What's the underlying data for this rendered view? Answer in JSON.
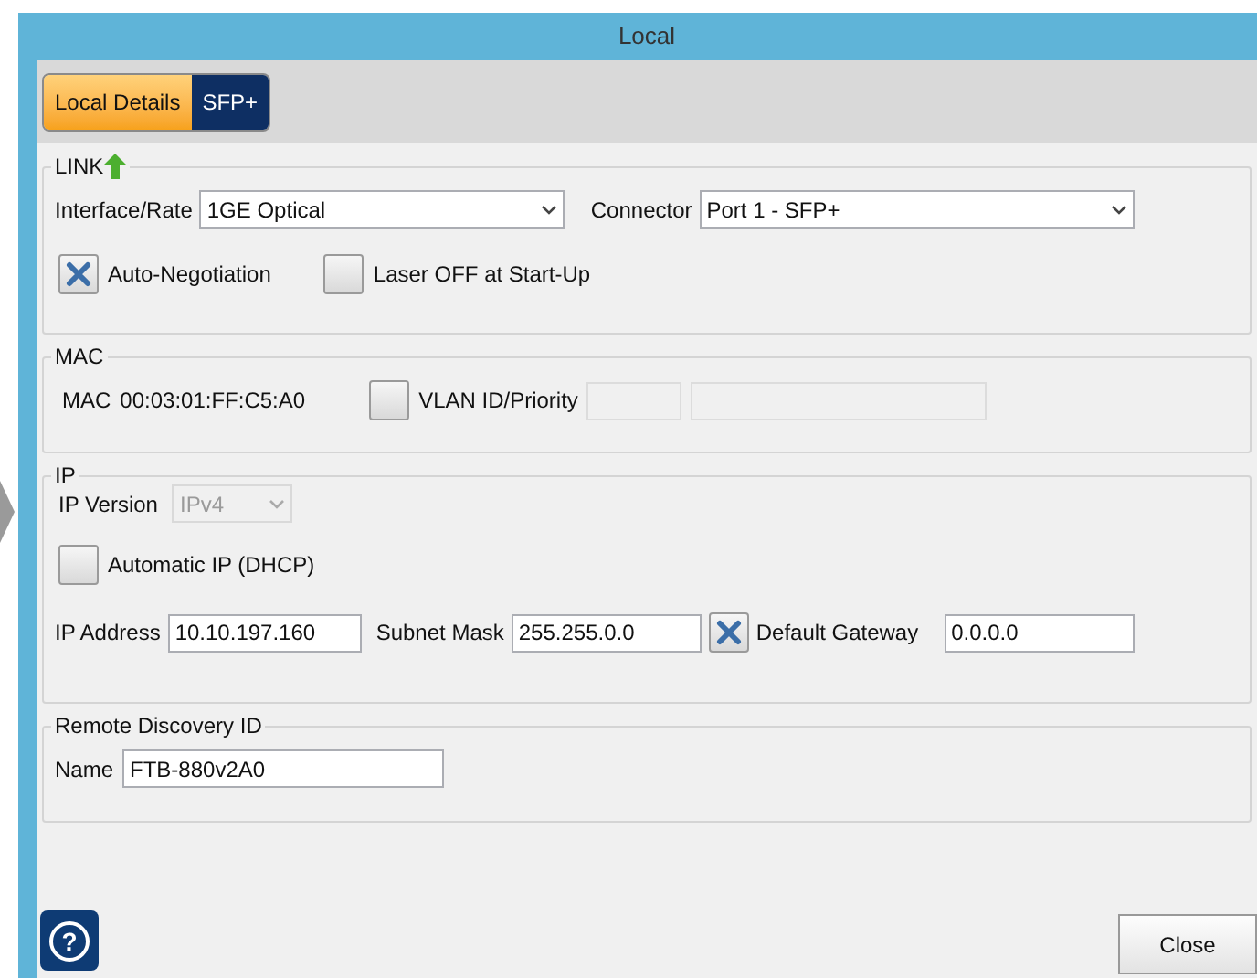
{
  "window": {
    "title": "Local"
  },
  "tabs": [
    {
      "label": "Local Details",
      "selected": true
    },
    {
      "label": "SFP+",
      "selected": false
    }
  ],
  "link": {
    "title": "LINK",
    "interface_rate": {
      "label": "Interface/Rate",
      "value": "1GE Optical"
    },
    "connector": {
      "label": "Connector",
      "value": "Port 1 - SFP+"
    },
    "auto_negotiation": {
      "label": "Auto-Negotiation",
      "checked": true
    },
    "laser_off": {
      "label": "Laser OFF at Start-Up",
      "checked": false
    }
  },
  "mac": {
    "title": "MAC",
    "label": "MAC",
    "value": "00:03:01:FF:C5:A0",
    "vlan": {
      "label": "VLAN ID/Priority",
      "checked": false
    }
  },
  "ip": {
    "title": "IP",
    "ip_version": {
      "label": "IP Version",
      "value": "IPv4",
      "disabled": true
    },
    "automatic_ip": {
      "label": "Automatic IP (DHCP)",
      "checked": false
    },
    "ip_address": {
      "label": "IP Address",
      "value": "10.10.197.160"
    },
    "subnet_mask": {
      "label": "Subnet Mask",
      "value": "255.255.0.0"
    },
    "default_gateway": {
      "label": "Default Gateway",
      "value": "0.0.0.0",
      "checked": true
    }
  },
  "remote_discovery": {
    "title": "Remote Discovery ID",
    "name": {
      "label": "Name",
      "value": "FTB-880v2A0"
    }
  },
  "help_button": {
    "symbol": "?"
  },
  "close_button": {
    "label": "Close"
  }
}
